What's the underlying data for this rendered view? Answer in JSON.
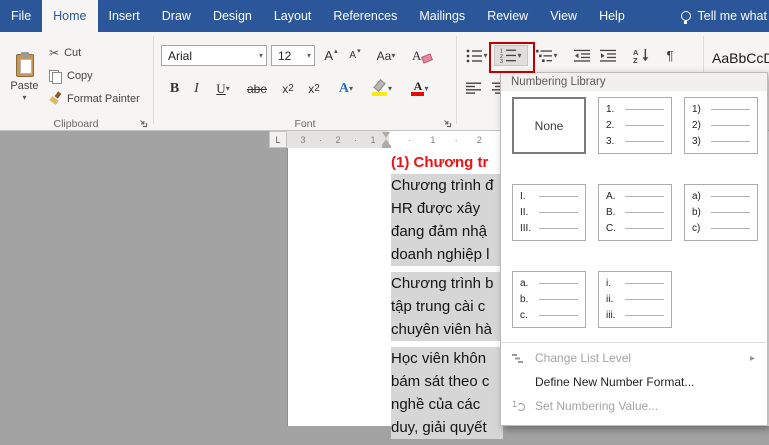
{
  "colors": {
    "ribbon_blue": "#2b579a",
    "ribbon_bg": "#f6f5f3",
    "callout_red": "#c00000",
    "heading_red": "#ee1111",
    "selection_gray": "#d6d6d6",
    "workspace_gray": "#a3a3a3",
    "font_color_bar": "#e00c0c",
    "highlight_bar": "#ffe81a"
  },
  "icons": {
    "dropdown_arrow": "▾",
    "submenu_arrow": "▸",
    "up_arrow": "▴",
    "down_arrow": "▾",
    "scissors": "✂",
    "pilcrow": "¶"
  },
  "ribbon": {
    "tabs": [
      {
        "label": "File",
        "active": false
      },
      {
        "label": "Home",
        "active": true
      },
      {
        "label": "Insert",
        "active": false
      },
      {
        "label": "Draw",
        "active": false
      },
      {
        "label": "Design",
        "active": false
      },
      {
        "label": "Layout",
        "active": false
      },
      {
        "label": "References",
        "active": false
      },
      {
        "label": "Mailings",
        "active": false
      },
      {
        "label": "Review",
        "active": false
      },
      {
        "label": "View",
        "active": false
      },
      {
        "label": "Help",
        "active": false
      }
    ],
    "tell_me": "Tell me what"
  },
  "clipboard_group": {
    "label": "Clipboard",
    "paste": "Paste",
    "cut": "Cut",
    "copy": "Copy",
    "format_painter": "Format Painter"
  },
  "font_group": {
    "label": "Font",
    "font_name": "Arial",
    "font_size": "12",
    "grow_font": "A",
    "shrink_font": "A",
    "change_case": "Aa",
    "clear_formatting": "A",
    "bold": "B",
    "italic": "I",
    "underline": "U",
    "strikethrough": "abe",
    "sub_base": "x",
    "sub_small": "2",
    "sup_base": "x",
    "sup_small": "2",
    "text_effects": "A",
    "font_color_letter": "A"
  },
  "styles_group": {
    "preview": "AaBbCcD"
  },
  "numbering_dropdown": {
    "title": "Numbering Library",
    "options": [
      {
        "label": "None",
        "selected": true,
        "items": []
      },
      {
        "items": [
          "1.",
          "2.",
          "3."
        ]
      },
      {
        "items": [
          "1)",
          "2)",
          "3)"
        ]
      },
      {
        "items": [
          "I.",
          "II.",
          "III."
        ]
      },
      {
        "items": [
          "A.",
          "B.",
          "C."
        ]
      },
      {
        "items": [
          "a)",
          "b)",
          "c)"
        ]
      },
      {
        "items": [
          "a.",
          "b.",
          "c."
        ]
      },
      {
        "items": [
          "i.",
          "ii.",
          "iii."
        ]
      }
    ],
    "menu": [
      {
        "label": "Change List Level",
        "disabled": true,
        "submenu": true,
        "icon": "change-list-level-icon"
      },
      {
        "label": "Define New Number Format...",
        "disabled": false,
        "submenu": false,
        "icon": null
      },
      {
        "label": "Set Numbering Value...",
        "disabled": true,
        "submenu": false,
        "icon": "set-numbering-value-icon"
      }
    ]
  },
  "document": {
    "heading": "(1) Chương tr",
    "paragraphs": [
      {
        "lines": [
          "Chương trình đ",
          "HR được xây",
          "đang đảm nhậ",
          "doanh nghiệp l"
        ]
      },
      {
        "lines": [
          "Chương trình b",
          "tập trung cài c",
          "chuyên viên hà"
        ]
      },
      {
        "lines": [
          "Học viên khôn",
          "bám sát theo c",
          "nghề của các",
          "duy, giải quyết"
        ]
      }
    ],
    "ruler_left_marks": [
      "3",
      "·",
      "2",
      "·",
      "1"
    ],
    "ruler_right_marks": [
      "·",
      "1",
      "·",
      "2"
    ],
    "tab_selector": "L"
  }
}
